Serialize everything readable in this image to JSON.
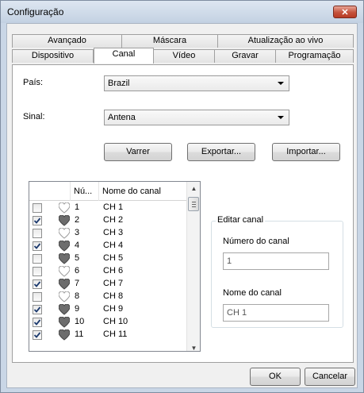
{
  "window": {
    "title": "Configuração",
    "close_label": "✕"
  },
  "tabs": {
    "row_back": [
      "Avançado",
      "Máscara",
      "Atualização ao vivo"
    ],
    "row_front": [
      "Dispositivo",
      "Canal",
      "Vídeo",
      "Gravar",
      "Programação"
    ],
    "active": "Canal"
  },
  "form": {
    "country_label": "País:",
    "country_value": "Brazil",
    "signal_label": "Sinal:",
    "signal_value": "Antena"
  },
  "buttons": {
    "scan": "Varrer",
    "export": "Exportar...",
    "import": "Importar..."
  },
  "channel_list": {
    "headers": [
      "Nú...",
      "Nome do canal"
    ],
    "rows": [
      {
        "checked": false,
        "fav": false,
        "num": "1",
        "name": "CH 1"
      },
      {
        "checked": true,
        "fav": true,
        "num": "2",
        "name": "CH 2"
      },
      {
        "checked": false,
        "fav": false,
        "num": "3",
        "name": "CH 3"
      },
      {
        "checked": true,
        "fav": true,
        "num": "4",
        "name": "CH 4"
      },
      {
        "checked": false,
        "fav": true,
        "num": "5",
        "name": "CH 5"
      },
      {
        "checked": false,
        "fav": false,
        "num": "6",
        "name": "CH 6"
      },
      {
        "checked": true,
        "fav": true,
        "num": "7",
        "name": "CH 7"
      },
      {
        "checked": false,
        "fav": false,
        "num": "8",
        "name": "CH 8"
      },
      {
        "checked": true,
        "fav": true,
        "num": "9",
        "name": "CH 9"
      },
      {
        "checked": true,
        "fav": true,
        "num": "10",
        "name": "CH 10"
      },
      {
        "checked": true,
        "fav": true,
        "num": "11",
        "name": "CH 11"
      }
    ]
  },
  "edit_channel": {
    "group_title": "Editar canal",
    "number_label": "Número do canal",
    "number_value": "1",
    "name_label": "Nome do canal",
    "name_value": "CH 1"
  },
  "footer": {
    "ok": "OK",
    "cancel": "Cancelar"
  },
  "icons": {
    "close": "close-icon",
    "dropdown": "chevron-down-icon",
    "favorite_filled": "heart-icon",
    "favorite_empty": "heart-outline-icon",
    "check": "checkmark-icon",
    "scroll_up": "scroll-up-icon",
    "scroll_down": "scroll-down-icon"
  },
  "colors": {
    "title_bar": "#c9d6e6",
    "close_button": "#c5523c",
    "heart_filled": "#6d6d6d",
    "heart_empty": "#9a9a9a"
  }
}
